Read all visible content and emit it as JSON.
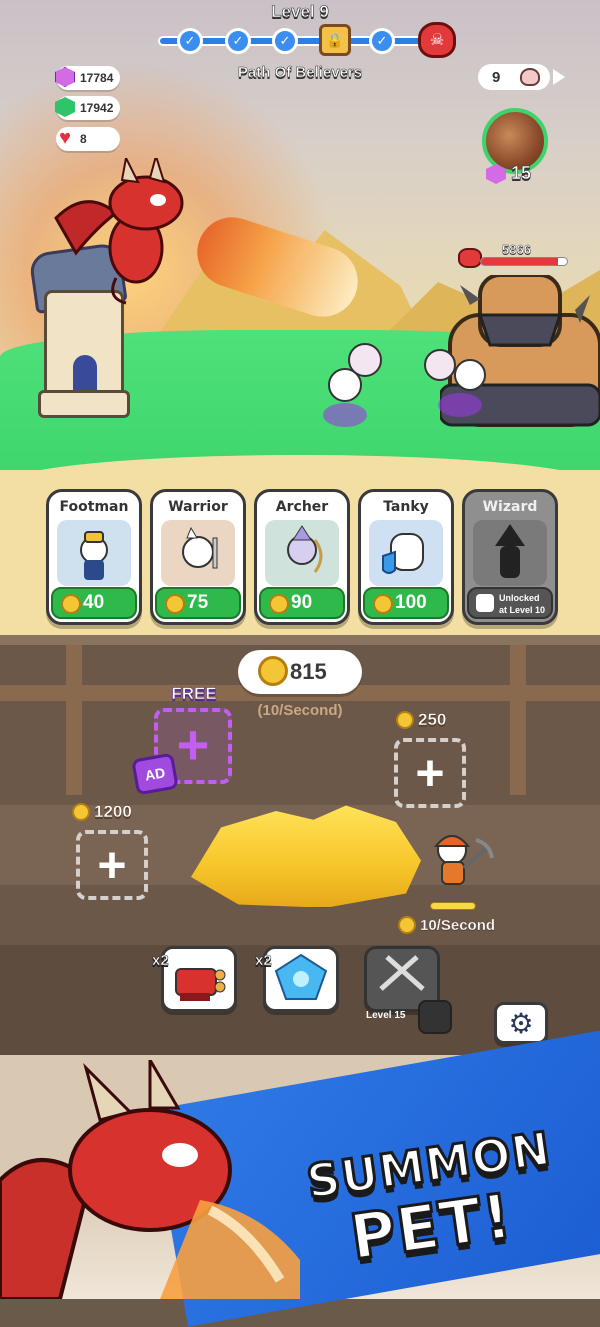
{
  "level": {
    "title": "Level 9",
    "path_name": "Path Of Believers",
    "nodes": [
      "check",
      "check",
      "check",
      "chest",
      "check",
      "boss"
    ]
  },
  "resources": {
    "pink_gems": "17784",
    "green_gems": "17942",
    "hearts": "8"
  },
  "skulls": "9",
  "meteor": {
    "gem_cost": "15"
  },
  "boss": {
    "hp": "5866",
    "hp_fraction": 0.9
  },
  "units": [
    {
      "name": "Footman",
      "price": "40"
    },
    {
      "name": "Warrior",
      "price": "75"
    },
    {
      "name": "Archer",
      "price": "90"
    },
    {
      "name": "Tanky",
      "price": "100"
    },
    {
      "name": "Wizard",
      "locked_text_1": "Unlocked",
      "locked_text_2": "at Level 10"
    }
  ],
  "mine": {
    "coins": "815",
    "rate": "(10/Second)",
    "free_label": "FREE",
    "ad_label": "AD",
    "slot_right_price": "250",
    "slot_left_price": "1200",
    "miner_rate": "10/Second"
  },
  "boosts": [
    {
      "mult": "x2",
      "icon": "cannon-icon"
    },
    {
      "mult": "x2",
      "icon": "crystal-icon"
    },
    {
      "level": "Level 15",
      "icon": "crossed-pickaxes-icon",
      "locked": true
    }
  ],
  "promo": {
    "line1": "SUMMON",
    "line2": "PET!"
  },
  "colors": {
    "accent_blue": "#2d7ee6",
    "price_green": "#2fb94a",
    "coin_gold": "#f4c534",
    "free_purple": "#c45ef2",
    "boss_red": "#e23a3a"
  }
}
